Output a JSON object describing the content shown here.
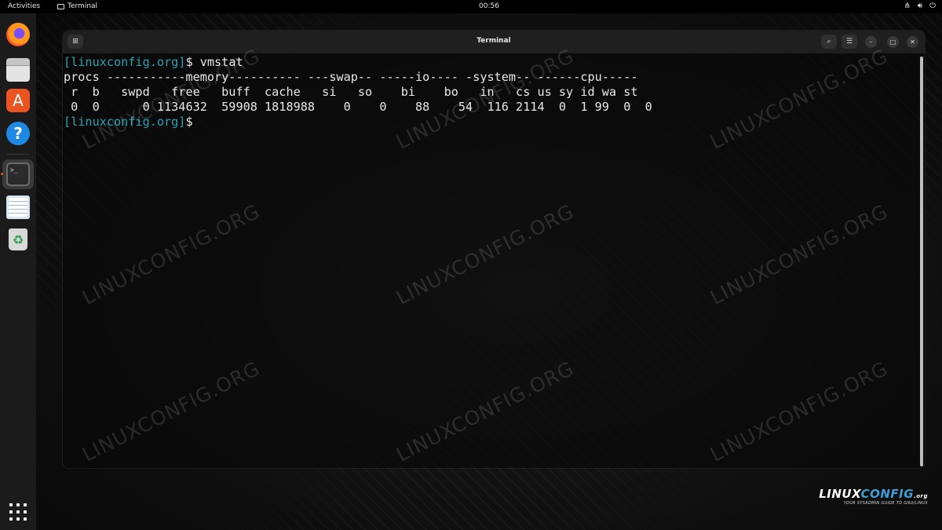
{
  "topbar": {
    "activities": "Activities",
    "app_name": "Terminal",
    "clock": "00:56",
    "tray": [
      "network-icon",
      "volume-icon",
      "power-icon"
    ]
  },
  "dock": {
    "items": [
      {
        "name": "firefox-icon"
      },
      {
        "name": "files-icon"
      },
      {
        "name": "app-center-icon"
      },
      {
        "name": "help-icon"
      },
      {
        "name": "terminal-icon",
        "running": true
      },
      {
        "name": "text-editor-icon"
      },
      {
        "name": "trash-icon"
      }
    ],
    "show_apps": "show-applications-icon"
  },
  "window": {
    "title": "Terminal",
    "buttons": [
      "new-tab-icon",
      "search-icon",
      "menu-icon",
      "minimize-icon",
      "maximize-icon",
      "close-icon"
    ]
  },
  "terminal": {
    "line1_prompt": "[linuxconfig.org]",
    "line1_cmd": "$ vmstat",
    "line2": "procs -----------memory---------- ---swap-- -----io---- -system-- ------cpu-----",
    "line3": " r  b   swpd   free   buff  cache   si   so    bi    bo   in   cs us sy id wa st",
    "line4": " 0  0      0 1134632  59908 1818988    0    0    88    54  116 2114  0  1 99  0  0",
    "line5_prompt": "[linuxconfig.org]",
    "line5_cmd": "$ "
  },
  "watermark": "LINUXCONFIG.ORG",
  "logo": {
    "brand_a": "LINUX",
    "brand_b": "CONFIG",
    "brand_c": ".org",
    "tagline": "YOUR SYSADMIN GUIDE TO GNU/LINUX"
  },
  "colors": {
    "prompt": "#2aa1b3",
    "accent": "#e95420"
  }
}
